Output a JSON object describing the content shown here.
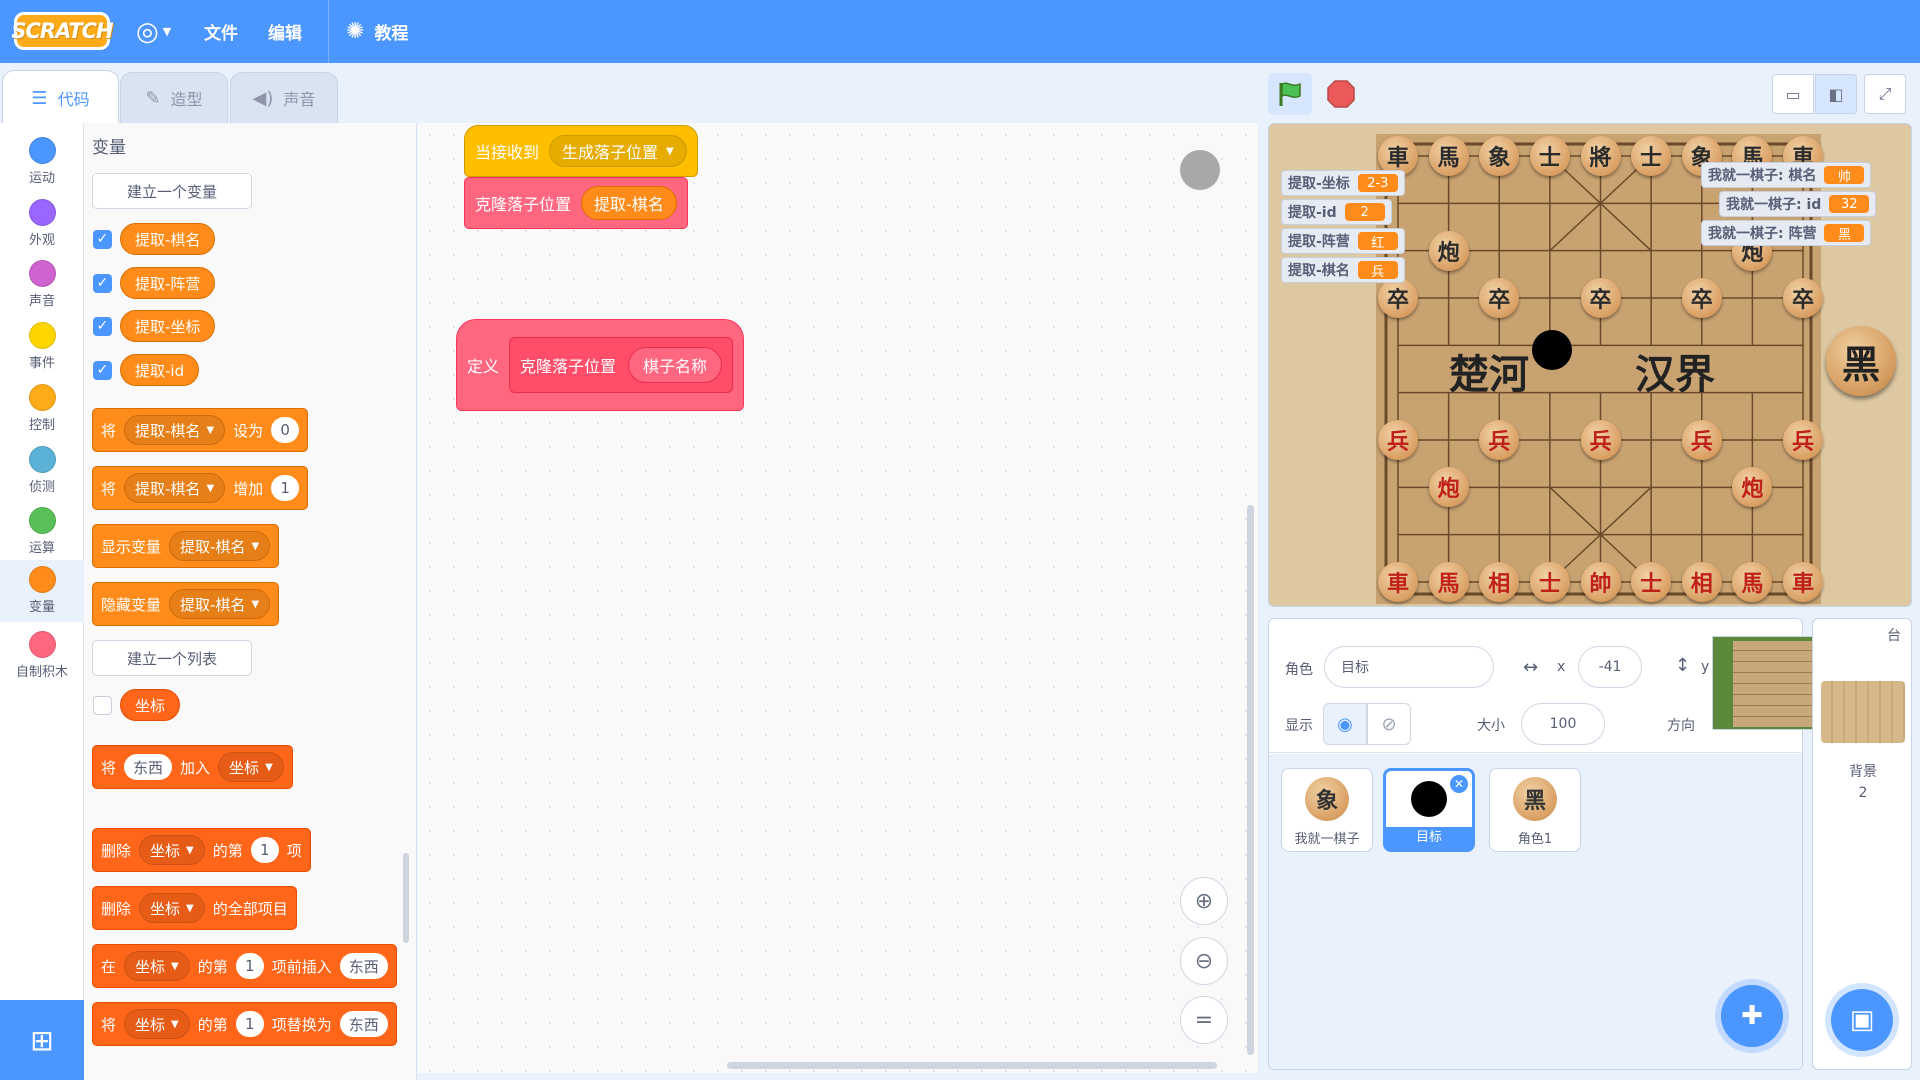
{
  "menubar": {
    "logo": "SCRATCH",
    "language_icon": "globe-icon",
    "file": "文件",
    "edit": "编辑",
    "tutorials": "教程"
  },
  "tabs": [
    {
      "label": "代码",
      "icon": "code-icon"
    },
    {
      "label": "造型",
      "icon": "brush-icon"
    },
    {
      "label": "声音",
      "icon": "speaker-icon"
    }
  ],
  "categories": [
    {
      "label": "运动",
      "color": "#4c97ff"
    },
    {
      "label": "外观",
      "color": "#9966ff"
    },
    {
      "label": "声音",
      "color": "#cf63cf"
    },
    {
      "label": "事件",
      "color": "#ffd500"
    },
    {
      "label": "控制",
      "color": "#ffab19"
    },
    {
      "label": "侦测",
      "color": "#5cb1d6"
    },
    {
      "label": "运算",
      "color": "#59c059"
    },
    {
      "label": "变量",
      "color": "#ff8c1a"
    },
    {
      "label": "自制积木",
      "color": "#ff6680"
    }
  ],
  "palette": {
    "heading": "变量",
    "make_variable": "建立一个变量",
    "variables": [
      "提取-棋名",
      "提取-阵营",
      "提取-坐标",
      "提取-id"
    ],
    "set_block": {
      "verb": "将",
      "var": "提取-棋名",
      "op": "设为",
      "value": "0"
    },
    "change_block": {
      "verb": "将",
      "var": "提取-棋名",
      "op": "增加",
      "value": "1"
    },
    "show_block": {
      "label": "显示变量",
      "var": "提取-棋名"
    },
    "hide_block": {
      "label": "隐藏变量",
      "var": "提取-棋名"
    },
    "make_list": "建立一个列表",
    "list_name": "坐标",
    "add_block": {
      "verb": "将",
      "value": "东西",
      "op": "加入",
      "list": "坐标"
    },
    "delete_block": {
      "verb": "删除",
      "list": "坐标",
      "of": "的第",
      "index": "1",
      "item": "项"
    },
    "delete_all_block": {
      "verb": "删除",
      "list": "坐标",
      "label": "的全部项目"
    },
    "insert_block": {
      "verb": "在",
      "list": "坐标",
      "of": "的第",
      "index": "1",
      "label": "项前插入",
      "value": "东西"
    },
    "replace_block": {
      "verb": "将",
      "list": "坐标",
      "of": "的第",
      "index": "1",
      "label": "项替换为",
      "value": "东西"
    }
  },
  "scripts": {
    "hat": {
      "label": "当接收到",
      "message": "生成落子位置"
    },
    "call": {
      "label": "克隆落子位置",
      "arg": "提取-棋名"
    },
    "define": {
      "label": "定义",
      "name": "克隆落子位置",
      "param": "棋子名称"
    }
  },
  "stage": {
    "river_left": "楚河",
    "river_right": "汉界",
    "big_piece": "黑",
    "black_pieces": [
      "車",
      "馬",
      "象",
      "士",
      "將",
      "士",
      "象",
      "馬",
      "車",
      "炮",
      "炮",
      "卒",
      "卒",
      "卒",
      "卒",
      "卒"
    ],
    "red_pieces": [
      "兵",
      "兵",
      "兵",
      "兵",
      "兵",
      "炮",
      "炮",
      "車",
      "馬",
      "相",
      "士",
      "帥",
      "士",
      "相",
      "馬",
      "車"
    ],
    "monitors_left": [
      {
        "label": "提取-坐标",
        "value": "2-3"
      },
      {
        "label": "提取-id",
        "value": "2"
      },
      {
        "label": "提取-阵营",
        "value": "红"
      },
      {
        "label": "提取-棋名",
        "value": "兵"
      }
    ],
    "monitors_right": [
      {
        "label": "我就一棋子: 棋名",
        "value": "帅"
      },
      {
        "label": "我就一棋子: id",
        "value": "32"
      },
      {
        "label": "我就一棋子: 阵营",
        "value": "黑"
      }
    ]
  },
  "sprite_info": {
    "sprite_label": "角色",
    "sprite_name": "目标",
    "x_label": "x",
    "x_value": "-41",
    "y_label": "y",
    "show_label": "显示",
    "size_label": "大小",
    "size_value": "100",
    "direction_label": "方向"
  },
  "sprites": [
    {
      "name": "我就一棋子",
      "glyph": "象"
    },
    {
      "name": "目标",
      "glyph": ""
    },
    {
      "name": "角色1",
      "glyph": "黑"
    }
  ],
  "stage_pane": {
    "header": "台",
    "backdrop_label": "背景",
    "backdrop_count": "2"
  }
}
